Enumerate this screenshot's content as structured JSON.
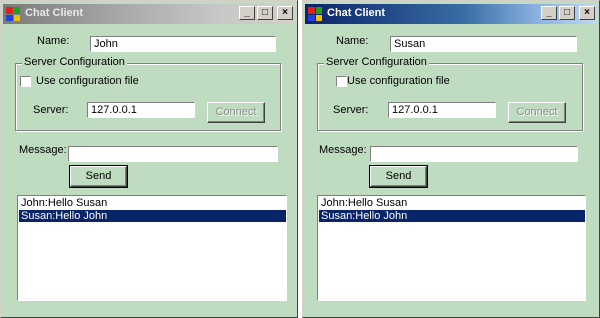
{
  "colors": {
    "window_bg": "#c0dcc0",
    "selection": "#0a246a",
    "active_title": "#0a246a"
  },
  "windows": [
    {
      "title": "Chat Client",
      "title_state": "inactive",
      "name_label": "Name:",
      "name_value": "John",
      "group_label": "Server Configuration",
      "config_checkbox_label": "Use configuration file",
      "config_checked": false,
      "server_label": "Server:",
      "server_value": "127.0.0.1",
      "connect_label": "Connect",
      "message_label": "Message:",
      "message_value": "",
      "send_label": "Send",
      "messages": [
        {
          "text": "John:Hello Susan",
          "selected": false
        },
        {
          "text": "Susan:Hello John",
          "selected": true
        }
      ]
    },
    {
      "title": "Chat Client",
      "title_state": "active",
      "name_label": "Name:",
      "name_value": "Susan",
      "group_label": "Server Configuration",
      "config_checkbox_label": "Use configuration file",
      "config_checked": false,
      "server_label": "Server:",
      "server_value": "127.0.0.1",
      "connect_label": "Connect",
      "message_label": "Message:",
      "message_value": "",
      "send_label": "Send",
      "messages": [
        {
          "text": "John:Hello Susan",
          "selected": false
        },
        {
          "text": "Susan:Hello John",
          "selected": true
        }
      ]
    }
  ],
  "caption_buttons": {
    "minimize": "_",
    "maximize": "□",
    "close": "×"
  }
}
